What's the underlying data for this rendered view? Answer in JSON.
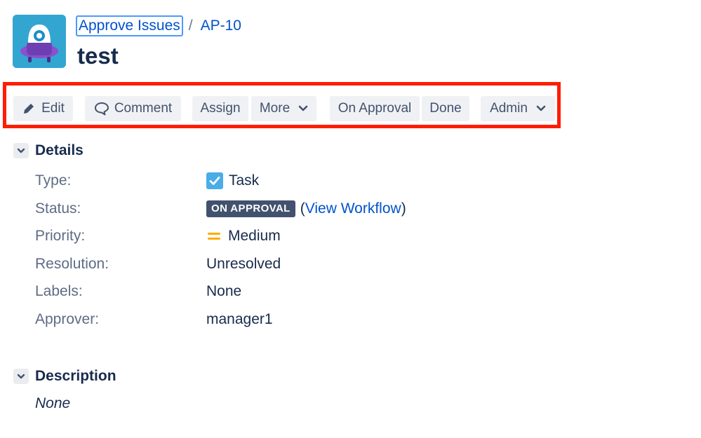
{
  "header": {
    "project_avatar_icon": "project-robot-avatar-icon",
    "breadcrumb_project": "Approve Issues",
    "breadcrumb_separator": "/",
    "breadcrumb_issue": "AP-10",
    "issue_title": "test"
  },
  "toolbar": {
    "edit": "Edit",
    "comment": "Comment",
    "assign": "Assign",
    "more": "More",
    "on_approval": "On Approval",
    "done": "Done",
    "admin": "Admin",
    "highlight_color": "#ff1d00"
  },
  "details": {
    "title": "Details",
    "fields": {
      "type": {
        "label": "Type:",
        "value": "Task",
        "icon": "task-checkbox-icon"
      },
      "status": {
        "label": "Status:",
        "value": "ON APPROVAL",
        "link_open": "(",
        "link": "View Workflow",
        "link_close": ")"
      },
      "priority": {
        "label": "Priority:",
        "value": "Medium",
        "icon": "priority-medium-icon"
      },
      "resolution": {
        "label": "Resolution:",
        "value": "Unresolved"
      },
      "labels": {
        "label": "Labels:",
        "value": "None"
      },
      "approver": {
        "label": "Approver:",
        "value": "manager1"
      }
    }
  },
  "description": {
    "title": "Description",
    "value": "None"
  },
  "colors": {
    "link": "#0052cc",
    "text": "#172b4d",
    "label": "#5e6c84",
    "button_bg": "#f0f1f4",
    "lozenge_bg": "#42526e",
    "priority_medium": "#ffab00",
    "task_icon": "#4bade8"
  }
}
